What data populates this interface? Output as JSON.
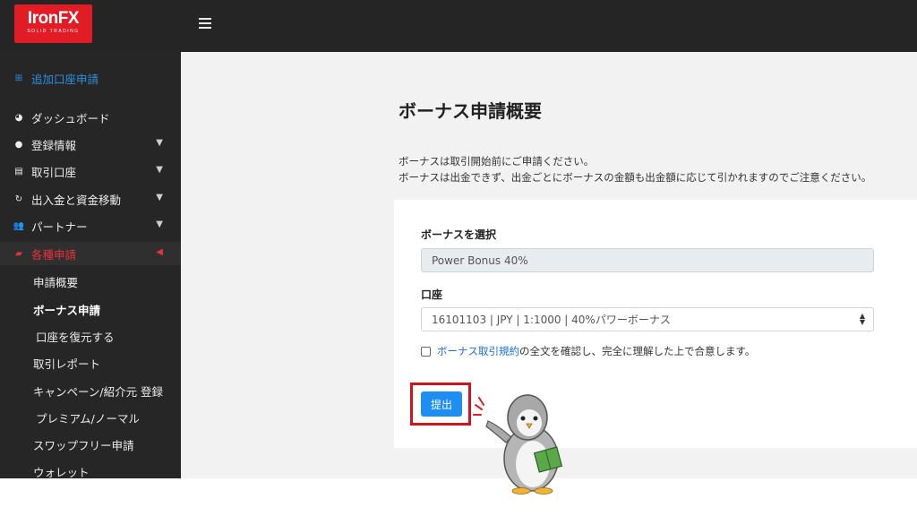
{
  "brand": {
    "name": "IronFX",
    "tagline": "SOLID TRADING"
  },
  "sidebar": {
    "add_account": "追加口座申請",
    "items": [
      {
        "label": "ダッシュボード"
      },
      {
        "label": "登録情報"
      },
      {
        "label": "取引口座"
      },
      {
        "label": "出入金と資金移動"
      },
      {
        "label": "パートナー"
      },
      {
        "label": "各種申請"
      }
    ],
    "subitems": [
      {
        "label": "申請概要"
      },
      {
        "label": "ボーナス申請"
      },
      {
        "label": "口座を復元する"
      },
      {
        "label": "取引レポート"
      },
      {
        "label": "キャンペーン/紹介元 登録"
      },
      {
        "label": "プレミアム/ノーマル"
      },
      {
        "label": "スワップフリー申請"
      },
      {
        "label": "ウォレット"
      }
    ]
  },
  "main": {
    "title": "ボーナス申請概要",
    "notice_line1": "ボーナスは取引開始前にご申請ください。",
    "notice_line2": "ボーナスは出金できず、出金ごとにボーナスの金額も出金額に応じて引かれますのでご注意ください。",
    "form": {
      "bonus_label": "ボーナスを選択",
      "bonus_value": "Power Bonus 40%",
      "account_label": "口座",
      "account_value": "16101103 | JPY | 1:1000 | 40%パワーボーナス",
      "terms_link": "ボーナス取引規約",
      "terms_text": "の全文を確認し、完全に理解した上で合意します。",
      "submit_label": "提出"
    }
  },
  "colors": {
    "brand_red": "#e11c24",
    "topbar": "#252525",
    "sidebar": "#262626",
    "active_red": "#e8333a",
    "link_blue": "#1a6fd1",
    "button_blue": "#1e8ef3",
    "highlight_red": "#d0131c"
  },
  "icons": [
    "hamburger-icon",
    "plus-square-icon",
    "dashboard-icon",
    "user-circle-icon",
    "card-icon",
    "sync-icon",
    "users-icon",
    "flag-icon",
    "chevron-down-icon",
    "chevron-left-icon",
    "select-arrows-icon",
    "penguin-mascot"
  ]
}
